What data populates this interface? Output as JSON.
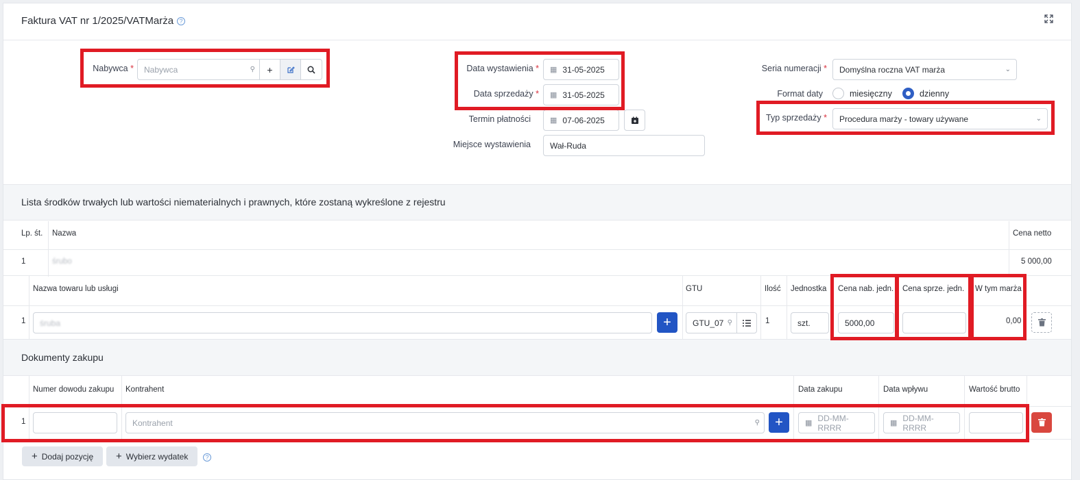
{
  "header": {
    "title": "Faktura VAT nr 1/2025/VATMarża",
    "help": "?",
    "expand_icon": "expand-icon"
  },
  "buyer": {
    "label": "Nabywca",
    "required": "*",
    "placeholder": "Nabywca"
  },
  "dates": {
    "issue_label": "Data wystawienia",
    "issue_value": "31-05-2025",
    "sale_label": "Data sprzedaży",
    "sale_value": "31-05-2025",
    "payment_label": "Termin płatności",
    "payment_value": "07-06-2025",
    "place_label": "Miejsce wystawienia",
    "place_value": "Wał-Ruda",
    "required": "*"
  },
  "right": {
    "series_label": "Seria numeracji",
    "series_value": "Domyślna roczna VAT marża",
    "format_label": "Format daty",
    "format_monthly": "miesięczny",
    "format_daily": "dzienny",
    "sale_type_label": "Typ sprzedaży",
    "sale_type_value": "Procedura marży - towary używane",
    "required": "*"
  },
  "assets": {
    "title": "Lista środków trwałych lub wartości niematerialnych i prawnych, które zostaną wykreślone z rejestru",
    "col_lp": "Lp. śt.",
    "col_name": "Nazwa",
    "col_net": "Cena netto",
    "row_lp": "1",
    "row_name": "śrubo",
    "row_net": "5 000,00"
  },
  "items": {
    "col_name": "Nazwa towaru lub usługi",
    "col_gtu": "GTU",
    "col_qty": "Ilość",
    "col_unit": "Jednostka",
    "col_buy": "Cena nab. jedn.",
    "col_sell": "Cena sprze. jedn.",
    "col_margin": "W tym marża",
    "row_lp": "1",
    "row_name": "śruba",
    "row_gtu": "GTU_07",
    "row_qty": "1",
    "row_unit": "szt.",
    "row_buy": "5000,00",
    "row_sell": "",
    "row_margin": "0,00"
  },
  "purchase": {
    "title": "Dokumenty zakupu",
    "col_doc": "Numer dowodu zakupu",
    "col_contractor": "Kontrahent",
    "col_date": "Data zakupu",
    "col_inflow": "Data wpływu",
    "col_gross": "Wartość brutto",
    "row_lp": "1",
    "contractor_placeholder": "Kontrahent",
    "date_placeholder": "DD-MM-RRRR",
    "inflow_placeholder": "DD-MM-RRRR"
  },
  "actions": {
    "add_position": "Dodaj pozycję",
    "choose_expense": "Wybierz wydatek"
  },
  "colors": {
    "accent": "#2255c4",
    "highlight": "#e01b24",
    "danger": "#d9473f"
  }
}
